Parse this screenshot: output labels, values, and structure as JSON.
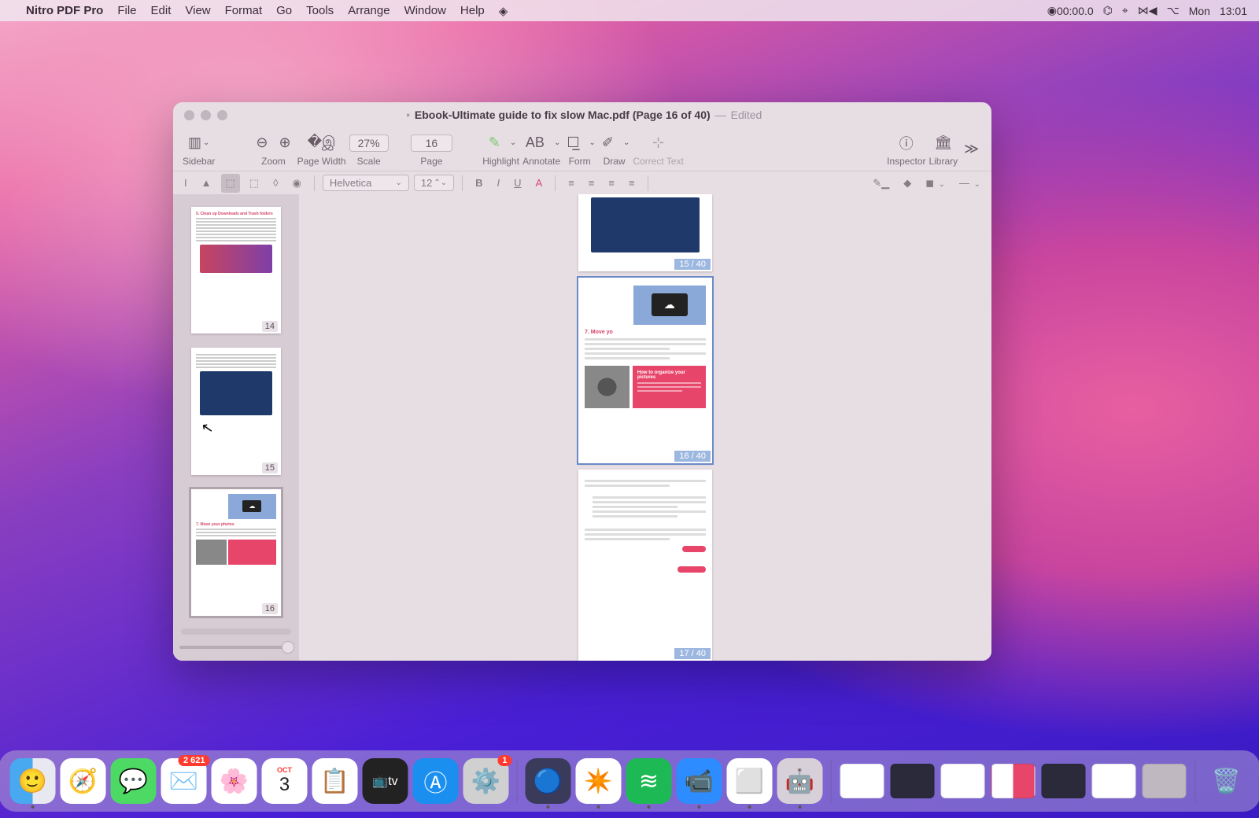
{
  "menubar": {
    "app": "Nitro PDF Pro",
    "items": [
      "File",
      "Edit",
      "View",
      "Format",
      "Go",
      "Tools",
      "Arrange",
      "Window",
      "Help"
    ],
    "right": {
      "rec": "00:00.0",
      "day": "Mon",
      "time": "13:01"
    }
  },
  "window": {
    "title_icon": "📄",
    "title": "Ebook-Ultimate guide to fix slow Mac.pdf (Page 16 of 40)",
    "edited_sep": "—",
    "edited": "Edited"
  },
  "toolbar": {
    "sidebar": "Sidebar",
    "zoom_pct": "27%",
    "pagewidth": "Page Width",
    "zoom": "Zoom",
    "scale": "Scale",
    "page_num": "16",
    "page": "Page",
    "highlight": "Highlight",
    "annotate": "Annotate",
    "form": "Form",
    "draw": "Draw",
    "correct": "Correct Text",
    "inspector": "Inspector",
    "library": "Library"
  },
  "toolbar2": {
    "font": "Helvetica",
    "size": "12"
  },
  "thumbs": [
    {
      "num": "14",
      "heading": "5. Clean up Downloads and Trash folders"
    },
    {
      "num": "15",
      "heading": ""
    },
    {
      "num": "16",
      "heading": "7. Move your photos"
    }
  ],
  "pages": {
    "p15": "15 / 40",
    "p16": "16 / 40",
    "p17": "17 / 40",
    "p16_heading": "7. Move yo",
    "p16_callout_title": "How to organize your pictures"
  },
  "dock": {
    "mail_badge": "2 621",
    "sys_badge": "1",
    "cal_month": "OCT",
    "cal_day": "3"
  }
}
